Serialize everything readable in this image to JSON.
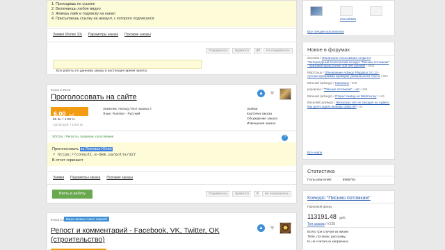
{
  "top_card": {
    "steps": [
      "1. Проходишь по ссылке",
      "2. Включаешь любое видео",
      "3. Жмешь лайк и подписку на канал",
      "4. Присылаешь ссылку на аккаунт, с которого подписался"
    ],
    "tabs": [
      "Заявки (более 10)",
      "Параметры заказа",
      "Похожие заказы"
    ],
    "pagination": [
      "Понравилось",
      "Нравится",
      "97",
      "Не понравилось"
    ],
    "notice": "Все работы по данному заказу в настоящее время заняты"
  },
  "order": {
    "time": "вчера в 18:25",
    "title": "Проголосовать на сайте",
    "price": "6.00",
    "price_unit": "руб.",
    "meta_line1": "50 пк. / 1.00 %",
    "meta_line2": "120.00 руб. / 1000 пк.",
    "customer_label": "Заказчик:",
    "customer": "Hurarg",
    "customer_links": "/ Все заказы ≠",
    "language": "Язык: Russian - Русский",
    "side_links": [
      "Заявки",
      "Карточка заказа",
      "Обсуждение заказа",
      "Извещения заказа"
    ],
    "category": "SOCIAL / Репосты, подписки, голосования",
    "desc_prefix": "Проголосовать ",
    "desc_highlight": "за Ялковая Юлия",
    "desc_url": "https://consult.e-dem.ua/polls/327",
    "desc_url_prefix": "↗",
    "desc_tail": "В отчет скриншот",
    "tabs": [
      "Заявки",
      "Параметры заказа",
      "Похожие заказы"
    ],
    "take_button": "Взять в работу",
    "pagination": [
      "Понравилось",
      "Нравится",
      "0",
      "Не понравилось"
    ]
  },
  "order2": {
    "time": "вчера в 16:46",
    "badge": "Ваша заявка станет первой!",
    "title": "Репост и комментарий - Facebook, VK, Twitter, OK (строительство)"
  },
  "sidebar": {
    "user_name": "nlanv4k555",
    "all_best": "Все лучшие исполнители",
    "forum_title": "Новое в форумах",
    "forum_items": [
      {
        "who": "dozen65 /",
        "link": "Финальное голосование открыто! \"Литературный поэтический конкурс \"Письмо потомкам\" - призовой фонд более 100 000 рублей!",
        "cnt": "/ 3911"
      },
      {
        "who": "RBD'Gaus /",
        "link": "Обновление Advego Plagiatus 3.0.13 - лучшая программа проверки уникальности текста",
        "cnt": "/ 692"
      },
      {
        "who": "Евгений (advego) /",
        "link": "Накопило",
        "cnt": "/ 508"
      },
      {
        "who": "popopopo /",
        "link": "\"Письмо потомкам\" - чат",
        "cnt": "/ 186"
      },
      {
        "who": "Евгений (advego) /",
        "link": "Открыт вывод на Webmoney",
        "cnt": "/ 149"
      },
      {
        "who": "Василий (advego) /",
        "link": "Несколько лет не заходил на Адвего. Как долго ждать вывода средств?",
        "cnt": "/ 64"
      }
    ],
    "all_new": "Все новое",
    "stats_title": "Статистика",
    "users_label": "Пользователей:",
    "users_count": "5586784",
    "contest_title": "Конкурс \"Письмо потомкам\"",
    "prize_label": "Призовой фонд",
    "prize": "113191.48",
    "prize_unit": "руб.",
    "top_label": "Топ заказа",
    "top_num": "/ #135",
    "poem": [
      "Всего три случая из жизни",
      "Тебе, потомок, расскажу,",
      "И, не считая их капризных"
    ]
  },
  "colors": {
    "accent": "#2a5db0",
    "price": "#f39c12",
    "button": "#6aa84f",
    "badge": "#3b8fd6"
  }
}
